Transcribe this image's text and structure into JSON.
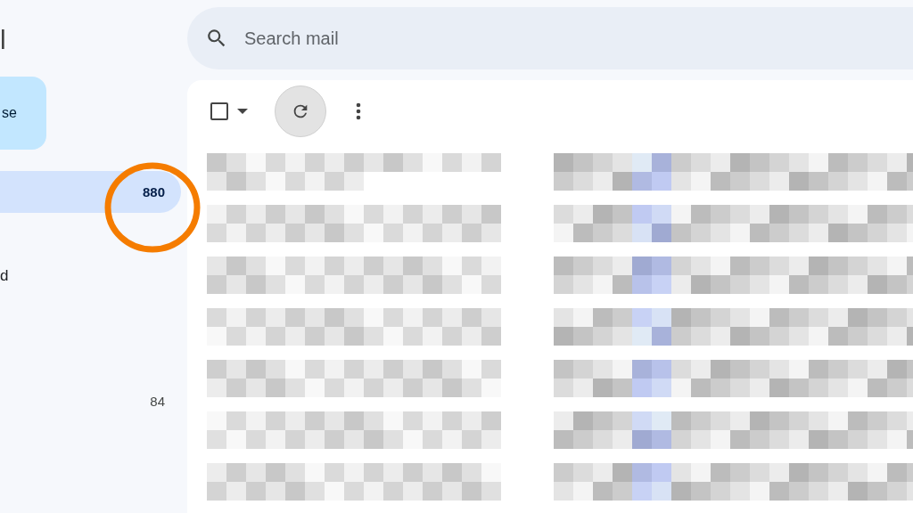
{
  "logo": {
    "text": "l"
  },
  "compose": {
    "label": "se"
  },
  "nav": [
    {
      "selected": true,
      "count": "880"
    },
    {
      "selected": false
    },
    {
      "selected": false,
      "label": "d"
    },
    {
      "selected": false
    },
    {
      "selected": false
    },
    {
      "selected": false,
      "count": "84"
    }
  ],
  "search": {
    "placeholder": "Search mail"
  },
  "toolbar": {
    "select_all": {
      "checked": false
    }
  },
  "annotation": {
    "kind": "circle"
  }
}
